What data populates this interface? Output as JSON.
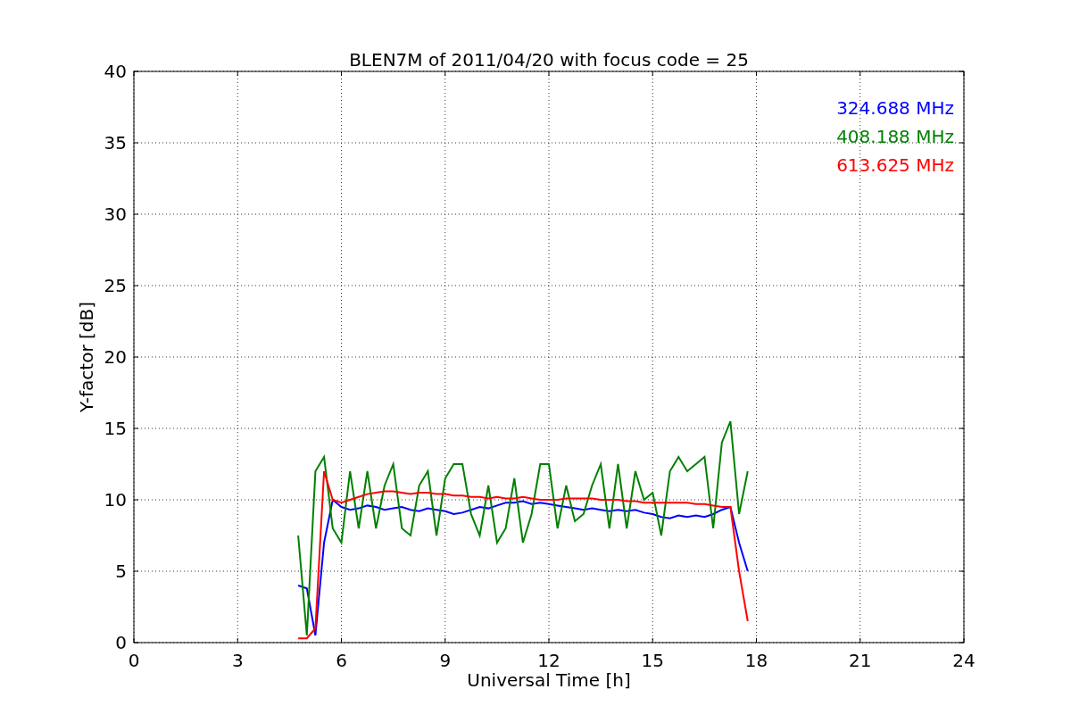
{
  "chart_data": {
    "type": "line",
    "title": "BLEN7M of 2011/04/20 with focus code = 25",
    "xlabel": "Universal Time [h]",
    "ylabel": "Y-factor [dB]",
    "x": [
      4.75,
      5,
      5.25,
      5.5,
      5.75,
      6,
      6.25,
      6.5,
      6.75,
      7,
      7.25,
      7.5,
      7.75,
      8,
      8.25,
      8.5,
      8.75,
      9,
      9.25,
      9.5,
      9.75,
      10,
      10.25,
      10.5,
      10.75,
      11,
      11.25,
      11.5,
      11.75,
      12,
      12.25,
      12.5,
      12.75,
      13,
      13.25,
      13.5,
      13.75,
      14,
      14.25,
      14.5,
      14.75,
      15,
      15.25,
      15.5,
      15.75,
      16,
      16.25,
      16.5,
      16.75,
      17,
      17.25,
      17.5,
      17.75
    ],
    "series": [
      {
        "name": "324.688 MHz",
        "color": "#0000ff",
        "values": [
          4,
          3.8,
          0.5,
          7,
          10,
          9.5,
          9.3,
          9.4,
          9.6,
          9.5,
          9.3,
          9.4,
          9.5,
          9.3,
          9.2,
          9.4,
          9.3,
          9.2,
          9,
          9.1,
          9.3,
          9.5,
          9.4,
          9.6,
          9.8,
          9.8,
          9.9,
          9.7,
          9.8,
          9.7,
          9.6,
          9.5,
          9.4,
          9.3,
          9.4,
          9.3,
          9.2,
          9.3,
          9.2,
          9.3,
          9.1,
          9,
          8.8,
          8.7,
          8.9,
          8.8,
          8.9,
          8.8,
          9,
          9.3,
          9.5,
          7,
          5
        ]
      },
      {
        "name": "408.188 MHz",
        "color": "#008000",
        "values": [
          7.5,
          0.5,
          12,
          13,
          8,
          7,
          12,
          8,
          12,
          8,
          11,
          12.5,
          8,
          7.5,
          11,
          12,
          7.5,
          11.5,
          12.5,
          12.5,
          9,
          7.5,
          11,
          7,
          8,
          11.5,
          7,
          9,
          12.5,
          12.5,
          8,
          11,
          8.5,
          9,
          11,
          12.5,
          8,
          12.5,
          8,
          12,
          10,
          10.5,
          7.5,
          12,
          13,
          12,
          12.5,
          13,
          8,
          14,
          15.5,
          9,
          12
        ]
      },
      {
        "name": "613.625 MHz",
        "color": "#ff0000",
        "values": [
          0.3,
          0.3,
          1,
          12,
          10,
          9.8,
          10,
          10.2,
          10.4,
          10.5,
          10.6,
          10.6,
          10.5,
          10.4,
          10.5,
          10.5,
          10.4,
          10.4,
          10.3,
          10.3,
          10.2,
          10.2,
          10.1,
          10.2,
          10.1,
          10.1,
          10.2,
          10.1,
          10,
          10,
          10,
          10.1,
          10.1,
          10.1,
          10.1,
          10,
          10,
          10,
          9.9,
          9.9,
          9.8,
          9.8,
          9.8,
          9.8,
          9.8,
          9.8,
          9.7,
          9.7,
          9.6,
          9.5,
          9.5,
          5,
          1.5
        ]
      }
    ],
    "xlim": [
      0,
      24
    ],
    "ylim": [
      0,
      40
    ],
    "xticks": [
      0,
      3,
      6,
      9,
      12,
      15,
      18,
      21,
      24
    ],
    "yticks": [
      0,
      5,
      10,
      15,
      20,
      25,
      30,
      35,
      40
    ],
    "grid": true
  }
}
